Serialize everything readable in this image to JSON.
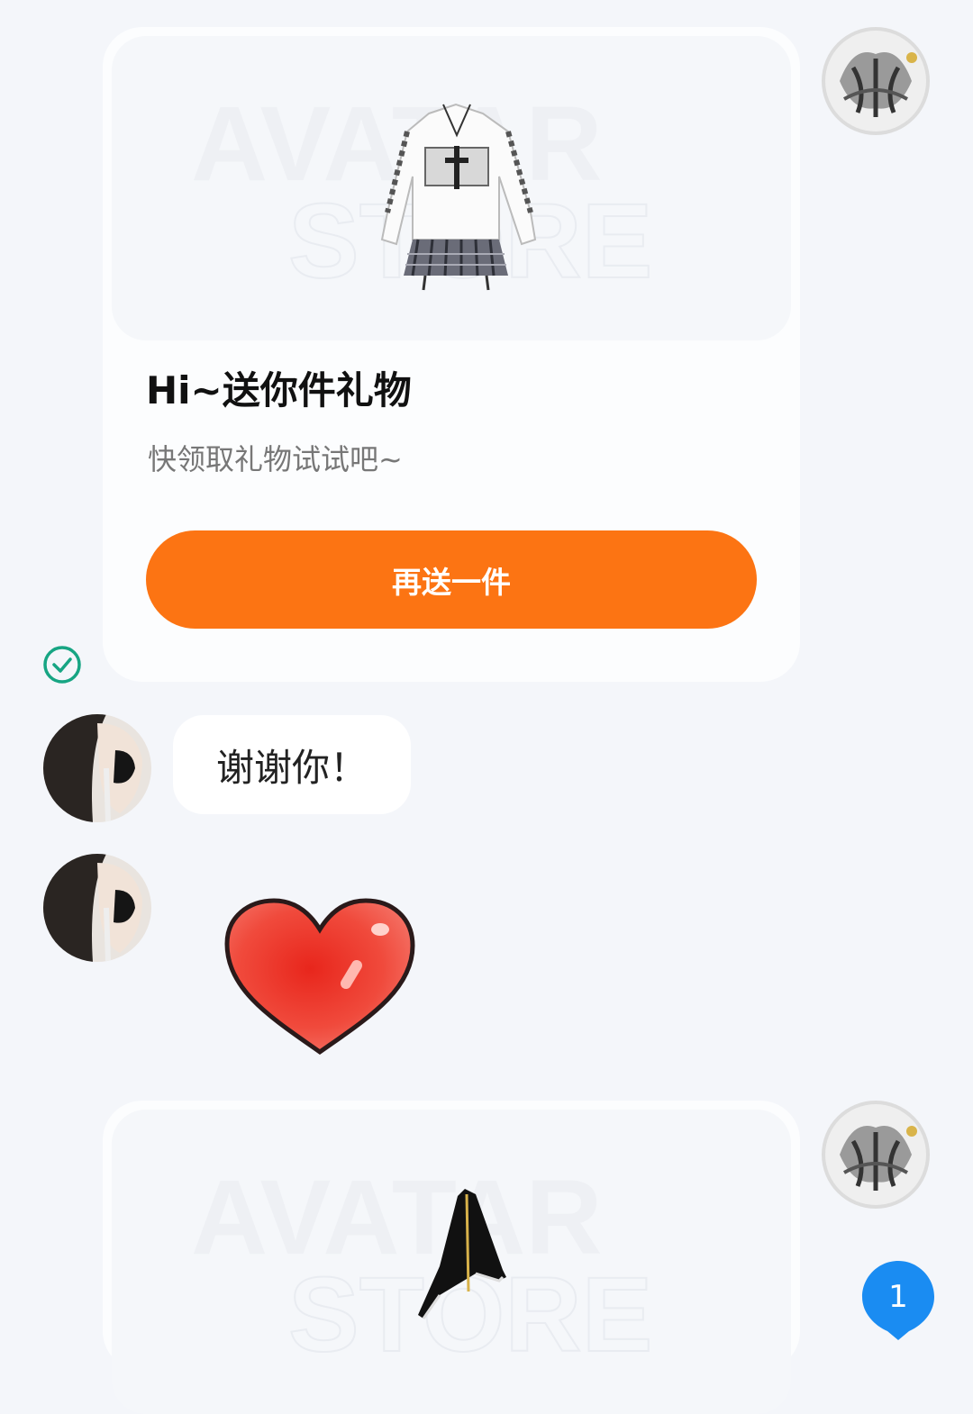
{
  "gift_card": {
    "title": "Hi~送你件礼物",
    "subtitle": "快领取礼物试试吧~",
    "button_label": "再送一件",
    "watermark_line1": "AVATAR",
    "watermark_line2": "STORE",
    "item_icon": "sweater-skirt-outfit"
  },
  "messages": [
    {
      "type": "text",
      "text": "谢谢你！"
    },
    {
      "type": "sticker",
      "icon": "heart-sticker"
    }
  ],
  "second_card": {
    "watermark_line1": "AVATAR",
    "watermark_line2": "STORE",
    "item_icon": "black-cape"
  },
  "unread_badge": {
    "count": "1"
  },
  "colors": {
    "accent": "#fc7413",
    "badge": "#1a8cf2",
    "check": "#17a583",
    "background": "#f4f6fa"
  }
}
